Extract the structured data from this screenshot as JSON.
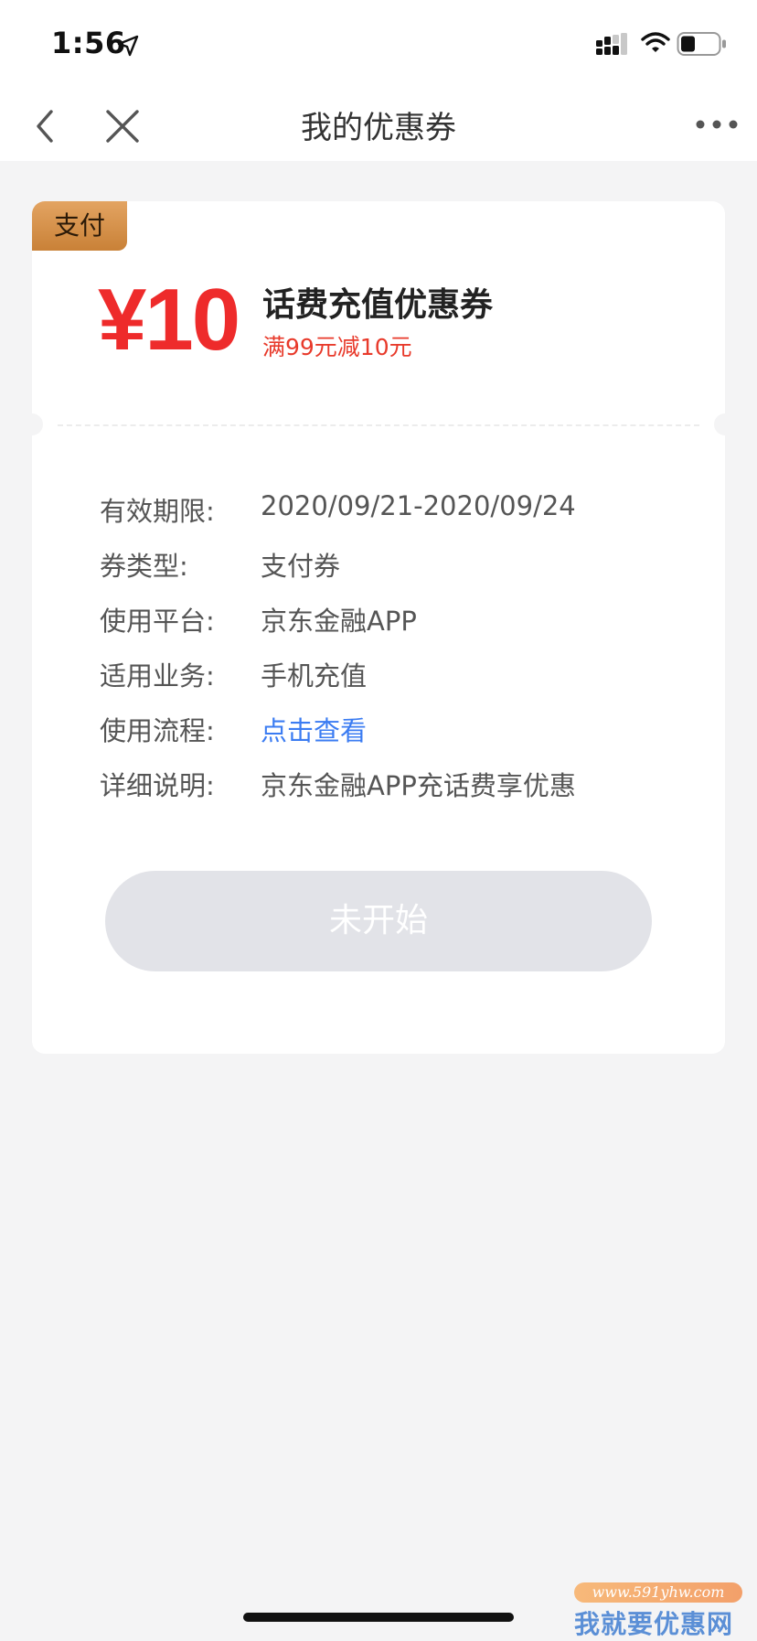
{
  "status_bar": {
    "time": "1:56"
  },
  "nav": {
    "title": "我的优惠券"
  },
  "coupon": {
    "tag": "支付",
    "amount": "¥10",
    "title": "话费充值优惠券",
    "condition": "满99元减10元",
    "details": [
      {
        "label": "有效期限:",
        "value": "2020/09/21-2020/09/24"
      },
      {
        "label": "券类型:",
        "value": "支付券"
      },
      {
        "label": "使用平台:",
        "value": "京东金融APP"
      },
      {
        "label": "适用业务:",
        "value": "手机充值"
      },
      {
        "label": "使用流程:",
        "value": "点击查看"
      },
      {
        "label": "详细说明:",
        "value": "京东金融APP充话费享优惠"
      }
    ],
    "button_label": "未开始"
  },
  "watermark": {
    "url": "www.591yhw.com",
    "text": "我就要优惠网"
  },
  "colors": {
    "amount_red": "#ee2b2b",
    "link_blue": "#3b7cf2",
    "tag_gold": "#d8944e",
    "page_bg": "#f4f4f5"
  }
}
